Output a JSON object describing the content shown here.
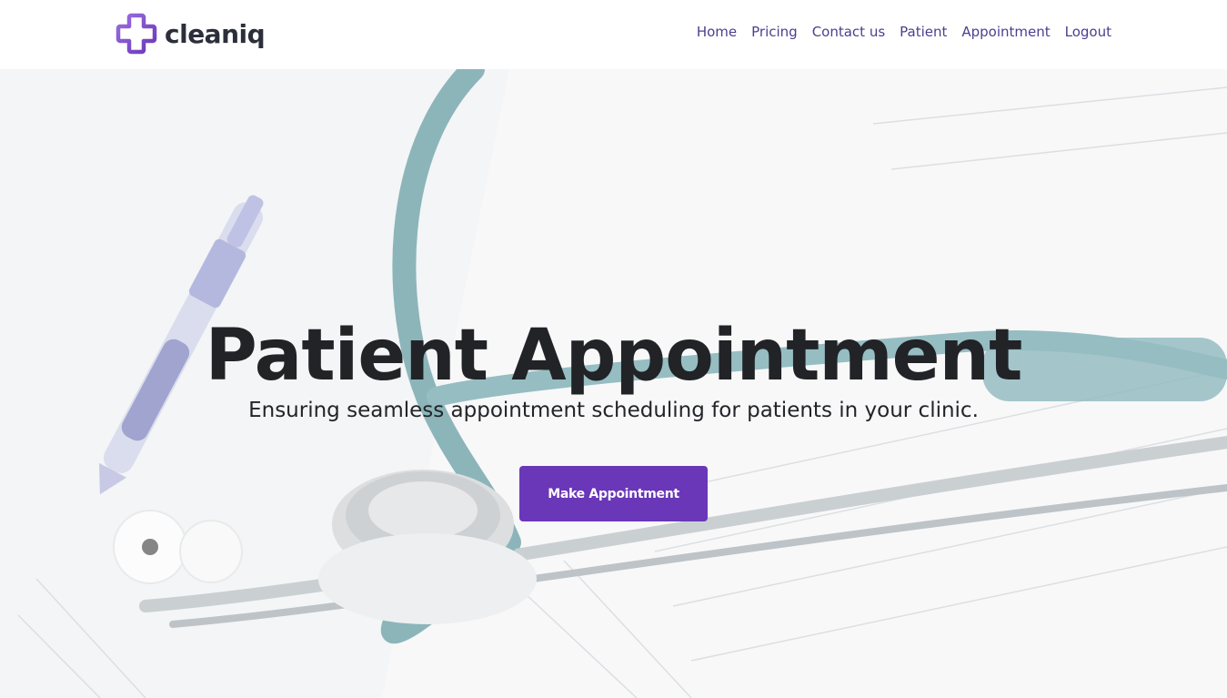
{
  "brand": {
    "name": "cleaniq",
    "logo_icon": "medical-cross-icon",
    "color_primary": "#6a37b8",
    "color_secondary": "#9b6fe0"
  },
  "nav": {
    "items": [
      {
        "label": "Home"
      },
      {
        "label": "Pricing"
      },
      {
        "label": "Contact us"
      },
      {
        "label": "Patient"
      },
      {
        "label": "Appointment"
      },
      {
        "label": "Logout"
      }
    ],
    "color": "#4b3f8f"
  },
  "hero": {
    "title": "Patient Appointment",
    "subtitle": "Ensuring seamless appointment scheduling for patients in your clinic.",
    "cta_label": "Make Appointment",
    "cta_color": "#6a37b8",
    "background_image": "stethoscope-pen-medical-form-photo"
  }
}
